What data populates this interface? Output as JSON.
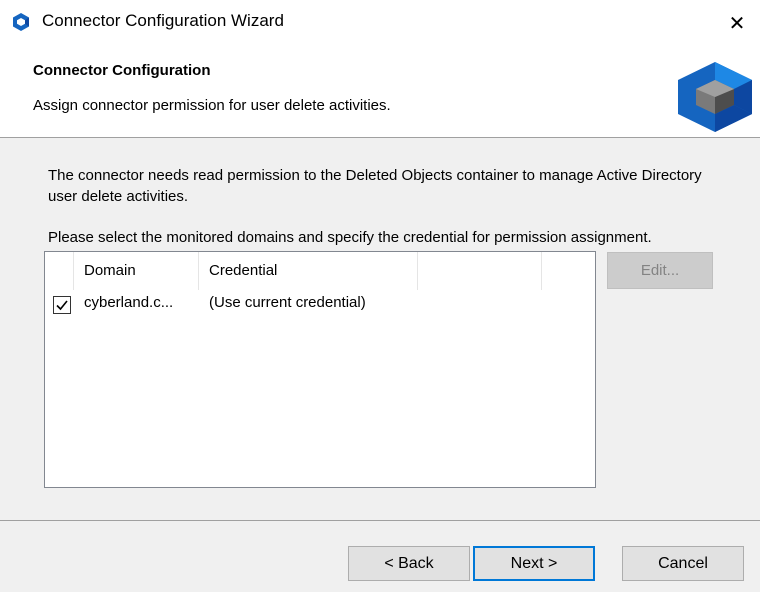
{
  "window": {
    "title": "Connector Configuration Wizard",
    "close_glyph": "✕",
    "accent": "#0078d7",
    "logo_colors": [
      "#1565c0",
      "#0d47a1",
      "#7a7a7a",
      "#4d4d4d"
    ]
  },
  "header": {
    "title": "Connector Configuration",
    "subtitle": "Assign connector permission for user delete activities."
  },
  "main": {
    "description": "The connector needs read permission to the Deleted Objects container to manage Active Directory user delete activities.",
    "instruction": "Please select the monitored domains and specify the credential for permission assignment.",
    "list": {
      "columns": [
        "Domain",
        "Credential"
      ],
      "rows": [
        {
          "checked": true,
          "check_glyph": "✓",
          "domain": "cyberland.c...",
          "credential": "(Use current credential)"
        }
      ]
    },
    "edit_button": "Edit..."
  },
  "footer": {
    "back_button": "< Back",
    "next_button": "Next >",
    "cancel_button": "Cancel"
  }
}
